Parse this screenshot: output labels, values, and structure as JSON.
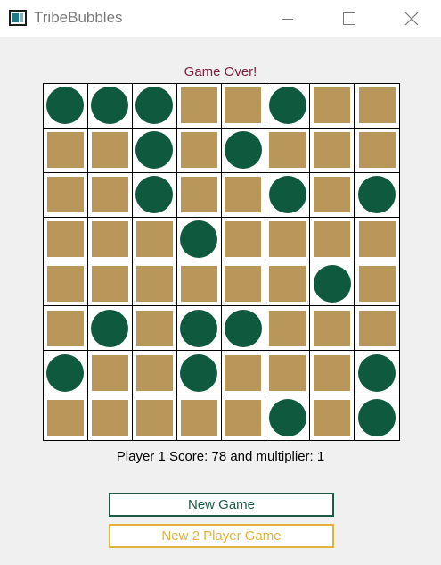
{
  "window": {
    "title": "TribeBubbles",
    "controls": [
      "minimize-icon",
      "maximize-icon",
      "close-icon"
    ]
  },
  "game": {
    "status": "Game Over!",
    "score_text": "Player 1 Score: 78 and multiplier: 1",
    "board": [
      [
        "bubble",
        "bubble",
        "bubble",
        "tile",
        "tile",
        "bubble",
        "tile",
        "tile"
      ],
      [
        "tile",
        "tile",
        "bubble",
        "tile",
        "bubble",
        "tile",
        "tile",
        "tile"
      ],
      [
        "tile",
        "tile",
        "bubble",
        "tile",
        "tile",
        "bubble",
        "tile",
        "bubble"
      ],
      [
        "tile",
        "tile",
        "tile",
        "bubble",
        "tile",
        "tile",
        "tile",
        "tile"
      ],
      [
        "tile",
        "tile",
        "tile",
        "tile",
        "tile",
        "tile",
        "bubble",
        "tile"
      ],
      [
        "tile",
        "bubble",
        "tile",
        "bubble",
        "bubble",
        "tile",
        "tile",
        "tile"
      ],
      [
        "bubble",
        "tile",
        "tile",
        "bubble",
        "tile",
        "tile",
        "tile",
        "bubble"
      ],
      [
        "tile",
        "tile",
        "tile",
        "tile",
        "tile",
        "bubble",
        "tile",
        "bubble"
      ]
    ]
  },
  "buttons": {
    "new_game": "New Game",
    "new_two_player": "New 2 Player Game"
  },
  "colors": {
    "bubble": "#0f5a3e",
    "tile": "#b9975b",
    "status": "#7a1f3d",
    "new_game_border": "#1e5a44",
    "two_player_border": "#e3b23c"
  }
}
